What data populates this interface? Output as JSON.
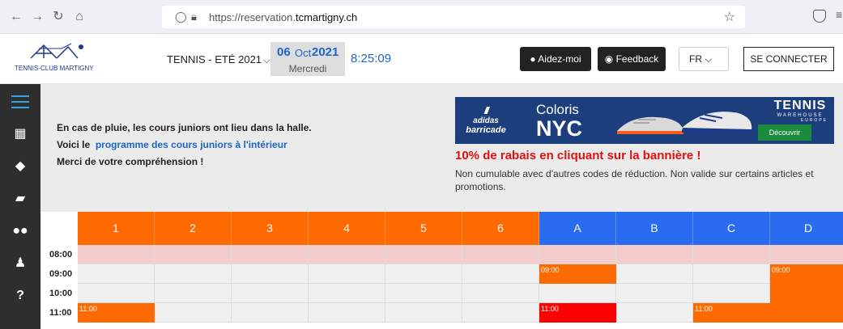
{
  "browser": {
    "url_prefix": "https://reservation.",
    "url_domain": "tcmartigny.ch"
  },
  "header": {
    "logo_text": "TENNIS-CLUB MARTIGNY",
    "season": "TENNIS - ETÉ 2021",
    "date_day": "06",
    "date_month": "Oct",
    "date_year": "2021",
    "date_weekday": "Mercredi",
    "clock": "8:25:09",
    "help_label": "Aidez-moi",
    "feedback_label": "Feedback",
    "language": "FR",
    "login_label": "SE CONNECTER"
  },
  "info": {
    "line1": "En cas de pluie, les cours juniors ont lieu dans la halle.",
    "line2_prefix": "Voici le",
    "line2_link": "programme des cours juniors à l'intérieur",
    "line3": "Merci de votre compréhension !"
  },
  "banner": {
    "brand1": "adidas",
    "brand2": "barricade",
    "coloris": "Coloris",
    "nyc": "NYC",
    "tw1": "TENNIS",
    "tw2": "WAREHOUSE",
    "tw3": "EUROPE",
    "discover": "Découvrir"
  },
  "promo": {
    "headline": "10% de rabais en cliquant sur la bannière !",
    "note": "Non cumulable avec d'autres codes de réduction. Non valide sur certains articles et promotions."
  },
  "colors": {
    "orange": "#ff6a00",
    "blue": "#2a6cf0",
    "red": "#ff0000",
    "pink_row": "#f4cccc"
  },
  "schedule": {
    "courts": [
      {
        "label": "1",
        "color": "#ff6a00"
      },
      {
        "label": "2",
        "color": "#ff6a00"
      },
      {
        "label": "3",
        "color": "#ff6a00"
      },
      {
        "label": "4",
        "color": "#ff6a00"
      },
      {
        "label": "5",
        "color": "#ff6a00"
      },
      {
        "label": "6",
        "color": "#ff6a00"
      },
      {
        "label": "A",
        "color": "#2a6cf0"
      },
      {
        "label": "B",
        "color": "#2a6cf0"
      },
      {
        "label": "C",
        "color": "#2a6cf0"
      },
      {
        "label": "D",
        "color": "#2a6cf0"
      }
    ],
    "times": [
      "08:00",
      "09:00",
      "10:00",
      "11:00"
    ],
    "bookings": [
      {
        "court": 6,
        "row": 1,
        "label": "09:00",
        "color": "#ff6a00"
      },
      {
        "court": 9,
        "row": 1,
        "label": "09:00",
        "color": "#ff6a00"
      },
      {
        "court": 0,
        "row": 3,
        "label": "11:00",
        "color": "#ff6a00"
      },
      {
        "court": 6,
        "row": 3,
        "label": "11:00",
        "color": "#ff0000"
      },
      {
        "court": 8,
        "row": 3,
        "label": "11:00",
        "color": "#ff6a00"
      }
    ]
  }
}
